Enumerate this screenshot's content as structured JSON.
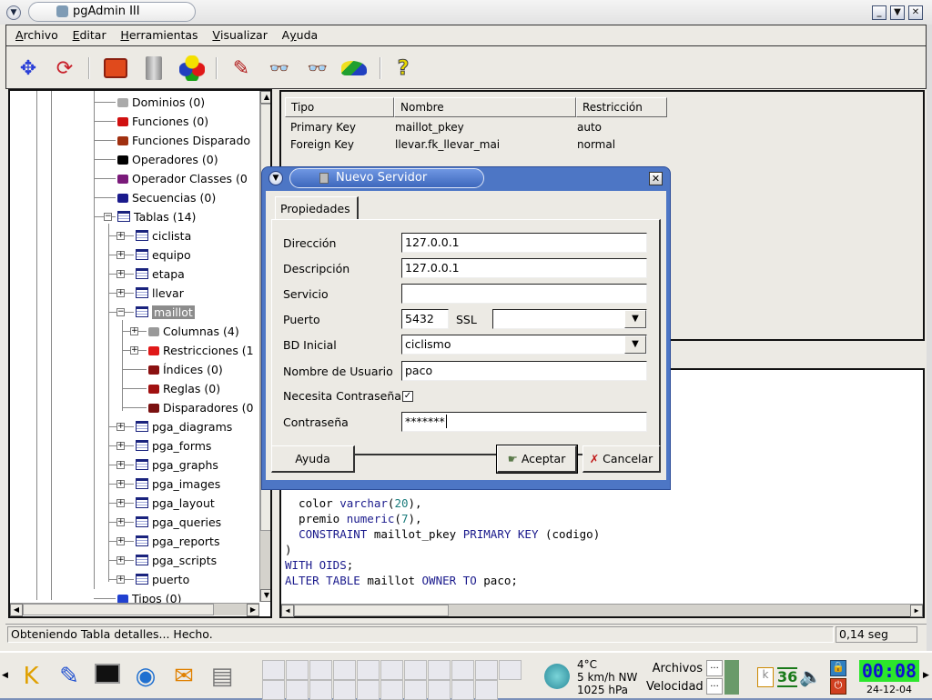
{
  "window": {
    "title": "pgAdmin III",
    "controls": [
      "minimize-icon",
      "shade-icon",
      "close-icon"
    ]
  },
  "menubar": {
    "items": [
      {
        "label": "Archivo",
        "mnemonic": "A"
      },
      {
        "label": "Editar",
        "mnemonic": "E"
      },
      {
        "label": "Herramientas",
        "mnemonic": "H"
      },
      {
        "label": "Visualizar",
        "mnemonic": "V"
      },
      {
        "label": "Ayuda",
        "mnemonic": "y"
      }
    ]
  },
  "toolbar": {
    "buttons": [
      {
        "name": "connect",
        "icon": "network-arrows-icon"
      },
      {
        "name": "refresh",
        "icon": "refresh-icon"
      },
      {
        "name": "create",
        "icon": "toolbox-icon"
      },
      {
        "name": "drop",
        "icon": "trash-icon"
      },
      {
        "name": "properties",
        "icon": "colored-balls-icon"
      },
      {
        "name": "sql",
        "icon": "pencil-sql-icon"
      },
      {
        "name": "view-data",
        "icon": "glasses-icon"
      },
      {
        "name": "view-filtered",
        "icon": "glasses-filter-icon"
      },
      {
        "name": "maintenance",
        "icon": "vacuum-icon"
      },
      {
        "name": "help",
        "icon": "help-icon"
      }
    ]
  },
  "tree": {
    "items": [
      {
        "label": "Dominios (0)",
        "icon": "domain-icon",
        "level": 0
      },
      {
        "label": "Funciones (0)",
        "icon": "function-icon",
        "level": 0
      },
      {
        "label": "Funciones Disparado",
        "icon": "trigger-function-icon",
        "level": 0
      },
      {
        "label": "Operadores (0)",
        "icon": "operator-icon",
        "level": 0
      },
      {
        "label": "Operador Classes (0",
        "icon": "operator-class-icon",
        "level": 0
      },
      {
        "label": "Secuencias (0)",
        "icon": "sequence-icon",
        "level": 0
      },
      {
        "label": "Tablas (14)",
        "icon": "table-icon",
        "level": 0,
        "expanded": true
      },
      {
        "label": "ciclista",
        "icon": "table-icon",
        "level": 1
      },
      {
        "label": "equipo",
        "icon": "table-icon",
        "level": 1
      },
      {
        "label": "etapa",
        "icon": "table-icon",
        "level": 1
      },
      {
        "label": "llevar",
        "icon": "table-icon",
        "level": 1
      },
      {
        "label": "maillot",
        "icon": "table-icon",
        "level": 1,
        "expanded": true,
        "selected": true
      },
      {
        "label": "Columnas (4)",
        "icon": "columns-icon",
        "level": 2,
        "expandable": true
      },
      {
        "label": "Restricciones (1",
        "icon": "constraints-icon",
        "level": 2,
        "expandable": true
      },
      {
        "label": "Índices (0)",
        "icon": "index-icon",
        "level": 2
      },
      {
        "label": "Reglas (0)",
        "icon": "rule-icon",
        "level": 2
      },
      {
        "label": "Disparadores (0",
        "icon": "trigger-icon",
        "level": 2
      },
      {
        "label": "pga_diagrams",
        "icon": "table-icon",
        "level": 1
      },
      {
        "label": "pga_forms",
        "icon": "table-icon",
        "level": 1
      },
      {
        "label": "pga_graphs",
        "icon": "table-icon",
        "level": 1
      },
      {
        "label": "pga_images",
        "icon": "table-icon",
        "level": 1
      },
      {
        "label": "pga_layout",
        "icon": "table-icon",
        "level": 1
      },
      {
        "label": "pga_queries",
        "icon": "table-icon",
        "level": 1
      },
      {
        "label": "pga_reports",
        "icon": "table-icon",
        "level": 1
      },
      {
        "label": "pga_scripts",
        "icon": "table-icon",
        "level": 1
      },
      {
        "label": "puerto",
        "icon": "table-icon",
        "level": 1
      },
      {
        "label": "Tipos (0)",
        "icon": "types-icon",
        "level": 0
      }
    ]
  },
  "properties": {
    "columns": [
      "Tipo",
      "Nombre",
      "Restricción"
    ],
    "rows": [
      [
        "Primary Key",
        "maillot_pkey",
        "auto"
      ],
      [
        "Foreign Key",
        "llevar.fk_llevar_mai",
        "normal"
      ]
    ]
  },
  "sql": {
    "lines": [
      [
        {
          "t": "  color ",
          "c": ""
        },
        {
          "t": "varchar",
          "c": "kw"
        },
        {
          "t": "(",
          "c": ""
        },
        {
          "t": "20",
          "c": "num"
        },
        {
          "t": "),",
          "c": ""
        }
      ],
      [
        {
          "t": "  premio ",
          "c": ""
        },
        {
          "t": "numeric",
          "c": "kw"
        },
        {
          "t": "(",
          "c": ""
        },
        {
          "t": "7",
          "c": "num"
        },
        {
          "t": "),",
          "c": ""
        }
      ],
      [
        {
          "t": "  ",
          "c": ""
        },
        {
          "t": "CONSTRAINT",
          "c": "kw"
        },
        {
          "t": " maillot_pkey ",
          "c": ""
        },
        {
          "t": "PRIMARY KEY",
          "c": "kw"
        },
        {
          "t": " (codigo)",
          "c": ""
        }
      ],
      [
        {
          "t": ")",
          "c": ""
        }
      ],
      [
        {
          "t": "WITH OIDS",
          "c": "kw"
        },
        {
          "t": ";",
          "c": ""
        }
      ],
      [
        {
          "t": "ALTER TABLE",
          "c": "kw"
        },
        {
          "t": " maillot ",
          "c": ""
        },
        {
          "t": "OWNER TO",
          "c": "kw"
        },
        {
          "t": " paco;",
          "c": ""
        }
      ]
    ]
  },
  "status": {
    "message": "Obteniendo Tabla detalles... Hecho.",
    "time": "0,14 seg"
  },
  "dialog": {
    "title": "Nuevo Servidor",
    "tab": "Propiedades",
    "fields": {
      "direccion_label": "Dirección",
      "direccion_value": "127.0.0.1",
      "descripcion_label": "Descripción",
      "descripcion_value": "127.0.0.1",
      "servicio_label": "Servicio",
      "servicio_value": "",
      "puerto_label": "Puerto",
      "puerto_value": "5432",
      "ssl_label": "SSL",
      "ssl_value": "",
      "bd_label": "BD Inicial",
      "bd_value": "ciclismo",
      "usuario_label": "Nombre de Usuario",
      "usuario_value": "paco",
      "necesita_label": "Necesita Contraseña",
      "necesita_checked": true,
      "password_label": "Contraseña",
      "password_value": "*******"
    },
    "buttons": {
      "help": "Ayuda",
      "ok": "Aceptar",
      "cancel": "Cancelar"
    }
  },
  "taskbar": {
    "launchers": [
      "kde-menu-icon",
      "kwrite-icon",
      "terminal-icon",
      "konqueror-icon",
      "kmail-icon",
      "knode-icon"
    ],
    "windows_row1": [
      "window-1",
      "window-2",
      "window-3",
      "pgadmin-sql-window",
      "window-5",
      "window-6",
      "window-7",
      "pdf-window",
      "window-9",
      "window-10",
      "window-11"
    ],
    "windows_row2": [
      "window-12",
      "window-13",
      "pgadmin-window",
      "acrobat-window",
      "window-15",
      "pdf-window-2",
      "pgadmin-window-2",
      "window-18",
      "window-19",
      "kde-window"
    ],
    "weather": {
      "temp": "4°C",
      "wind": "5 km/h NW",
      "pressure": "1025 hPa"
    },
    "net": {
      "files_label": "Archivos",
      "files_value": "...",
      "speed_label": "Velocidad",
      "speed_value": "..."
    },
    "clock": {
      "time": "00:08",
      "date": "24-12-04"
    },
    "tray_number": "36"
  }
}
